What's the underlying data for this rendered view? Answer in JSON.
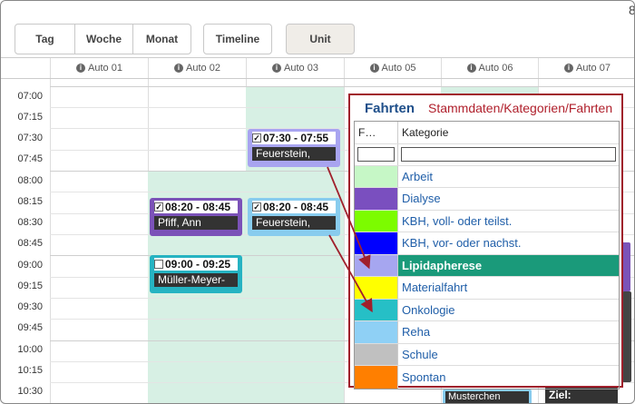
{
  "toolbar": {
    "day": "Tag",
    "week": "Woche",
    "month": "Monat",
    "timeline": "Timeline",
    "unit": "Unit",
    "corner": "8"
  },
  "columns": [
    "Auto 01",
    "Auto 02",
    "Auto 03",
    "Auto 05",
    "Auto 06",
    "Auto 07"
  ],
  "times": [
    "07:00",
    "07:15",
    "07:30",
    "07:45",
    "08:00",
    "08:15",
    "08:30",
    "08:45",
    "09:00",
    "09:15",
    "09:30",
    "09:45",
    "10:00",
    "10:15",
    "10:30"
  ],
  "events": [
    {
      "time": "07:30 - 07:55",
      "name": "Feuerstein,",
      "checked": true,
      "color": "#a8a4f0"
    },
    {
      "time": "08:20 - 08:45",
      "name": "Pfiff, Ann",
      "checked": true,
      "color": "#7b52b8"
    },
    {
      "time": "08:20 - 08:45",
      "name": "Feuerstein,",
      "checked": true,
      "color": "#88ccee"
    },
    {
      "time": "09:00 - 09:25",
      "name": "Müller-Meyer-",
      "checked": false,
      "color": "#26b3c2"
    }
  ],
  "bottom_fragments": {
    "col6": "Musterchen",
    "col7": "Ziel:"
  },
  "popup": {
    "title": "Fahrten",
    "path": "Stammdaten/Kategorien/Fahrten",
    "col_color": "F…",
    "col_category": "Kategorie",
    "categories": [
      {
        "label": "Arbeit",
        "color": "#c6f7c6"
      },
      {
        "label": "Dialyse",
        "color": "#7a4fbf"
      },
      {
        "label": "KBH, voll- oder teilst.",
        "color": "#7cfc00"
      },
      {
        "label": "KBH, vor- oder nachst.",
        "color": "#0000ff"
      },
      {
        "label": "Lipidapherese",
        "color": "#a6a6f0"
      },
      {
        "label": "Materialfahrt",
        "color": "#ffff00"
      },
      {
        "label": "Onkologie",
        "color": "#26bfc6"
      },
      {
        "label": "Reha",
        "color": "#8fd0f5"
      },
      {
        "label": "Schule",
        "color": "#c0c0c0"
      },
      {
        "label": "Spontan",
        "color": "#ff7f00"
      }
    ],
    "selected_index": 4,
    "accent": "#a0202c",
    "selected_color": "#1a9a7a"
  }
}
